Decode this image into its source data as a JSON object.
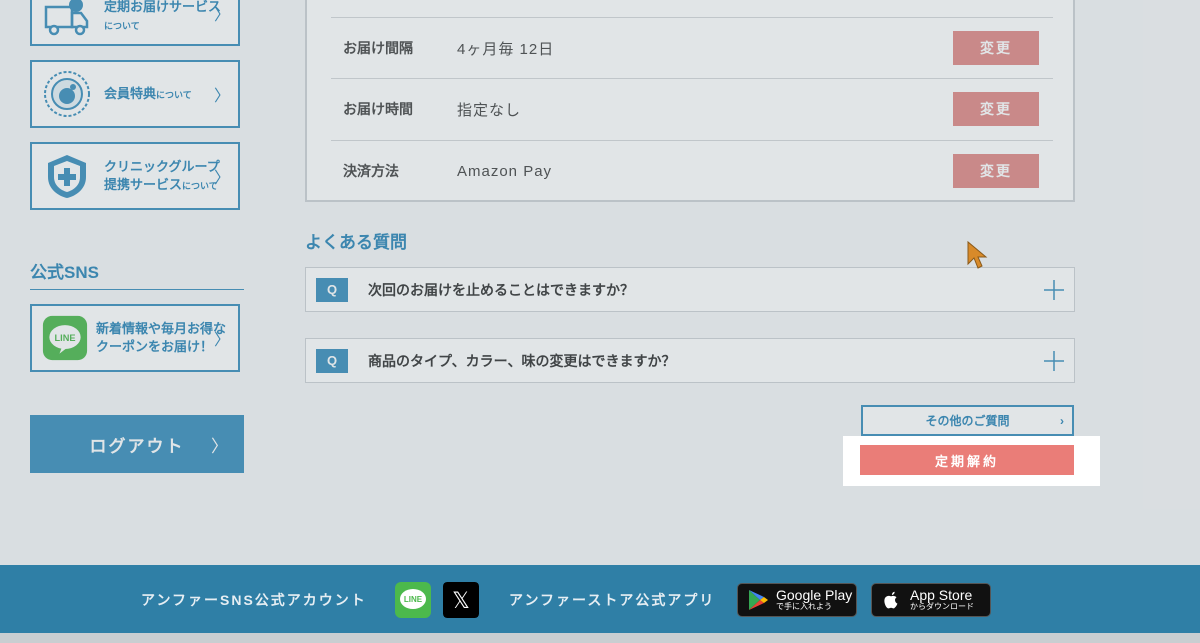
{
  "sidebar": {
    "cards": [
      {
        "title": "定期お届けサービス",
        "suffix": "について"
      },
      {
        "title": "会員特典",
        "suffix": "について"
      },
      {
        "title_line1": "クリニックグループ",
        "title_line2": "提携サービス",
        "suffix": "について"
      }
    ],
    "sns_title": "公式SNS",
    "line_card": {
      "line1": "新着情報や毎月お得な",
      "line2": "クーポンをお届け！",
      "icon_text": "LINE"
    },
    "logout_label": "ログアウト",
    "chevron": "〉"
  },
  "info": {
    "rows": [
      {
        "label": "お届け間隔",
        "value": "4ヶ月毎 12日",
        "button": "変更"
      },
      {
        "label": "お届け時間",
        "value": "指定なし",
        "button": "変更"
      },
      {
        "label": "決済方法",
        "value": "Amazon Pay",
        "button": "変更"
      }
    ]
  },
  "faq": {
    "title": "よくある質問",
    "q_badge": "Q",
    "items": [
      {
        "question": "次回のお届けを止めることはできますか？"
      },
      {
        "question": "商品のタイプ、カラー、味の変更はできますか？"
      }
    ],
    "other_label": "その他のご質問",
    "other_chevron": "›"
  },
  "cancel_label": "定期解約",
  "footer": {
    "sns_label": "アンファーSNS公式アカウント",
    "app_label": "アンファーストア公式アプリ",
    "line_icon_text": "LINE",
    "x_icon_text": "𝕏",
    "google_play": {
      "big": "Google Play",
      "small": "で手に入れよう"
    },
    "app_store": {
      "big": "App Store",
      "small": "からダウンロード"
    }
  },
  "colors": {
    "accent": "#3a8fbd",
    "change_button": "#e08a87",
    "cancel_button": "#ea7d78",
    "footer": "#2f7fa6"
  }
}
